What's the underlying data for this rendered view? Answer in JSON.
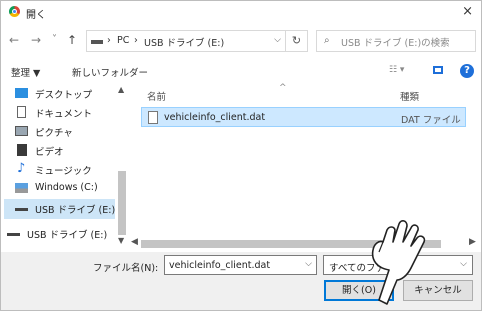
{
  "window": {
    "title": "開く",
    "close_glyph": "×"
  },
  "nav": {
    "back": "←",
    "forward": "→",
    "history": "˅",
    "up": "↑",
    "breadcrumbs": [
      "PC",
      "USB ドライブ (E:)"
    ],
    "separator": "›",
    "refresh": "↻",
    "search_placeholder": "USB ドライブ (E:)の検索"
  },
  "toolbar": {
    "organize": "整理 ▼",
    "new_folder": "新しいフォルダー",
    "help": "?"
  },
  "sidebar": {
    "items": [
      {
        "label": "デスクトップ",
        "icon": "desktop-icon"
      },
      {
        "label": "ドキュメント",
        "icon": "document-icon"
      },
      {
        "label": "ピクチャ",
        "icon": "picture-icon"
      },
      {
        "label": "ビデオ",
        "icon": "video-icon"
      },
      {
        "label": "ミュージック",
        "icon": "music-icon"
      },
      {
        "label": "Windows (C:)",
        "icon": "disk-icon"
      },
      {
        "label": "USB ドライブ (E:)",
        "icon": "usb-drive-icon"
      },
      {
        "label": "USB ドライブ (E:)",
        "icon": "usb-drive-icon"
      }
    ],
    "selected_index": 6
  },
  "columns": {
    "name": "名前",
    "type": "種類"
  },
  "files": [
    {
      "name": "vehicleinfo_client.dat",
      "type": "DAT ファイル"
    }
  ],
  "footer": {
    "filename_label": "ファイル名(N):",
    "filename_value": "vehicleinfo_client.dat",
    "filetype_value": "すべてのファイル",
    "open_button": "開く(O)",
    "cancel_button": "キャンセル"
  },
  "colors": {
    "accent": "#0078d7",
    "selection": "#cde8ff",
    "help": "#1e6fd9"
  }
}
